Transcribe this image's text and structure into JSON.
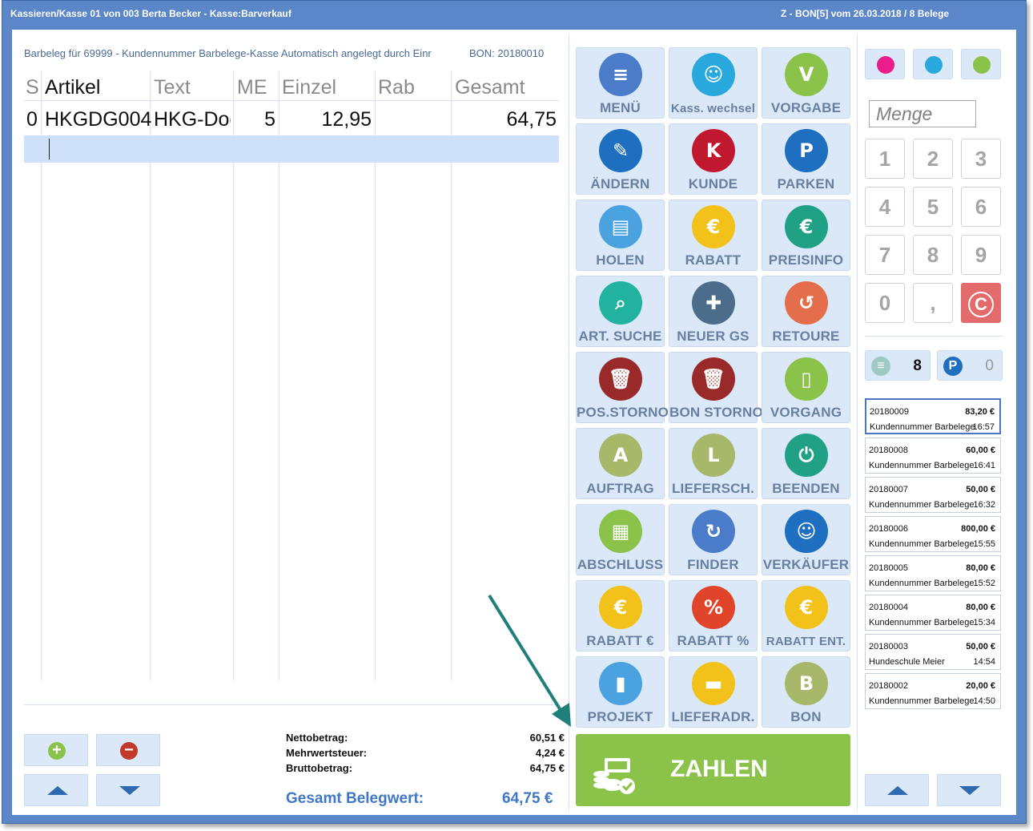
{
  "window": {
    "title_left": "Kassieren/Kasse 01 von 003 Berta Becker - Kasse:Barverkauf",
    "title_right": "Z - BON[5] vom 26.03.2018 / 8 Belege"
  },
  "receipt_info": {
    "description": "Barbeleg für 69999 - Kundennummer Barbelege-Kasse Automatisch angelegt durch Einr",
    "bon": "BON: 20180010"
  },
  "table": {
    "headers": [
      "S",
      "Artikel",
      "Text",
      "ME",
      "Einzel",
      "Rab",
      "Gesamt"
    ],
    "rows": [
      {
        "s": "0",
        "artikel": "HKGDG004",
        "text": "HKG-Dog",
        "me": "5",
        "einzel": "12,95",
        "rab": "",
        "gesamt": "64,75"
      }
    ]
  },
  "totals": {
    "netto_label": "Nettobetrag:",
    "netto_value": "60,51 €",
    "mwst_label": "Mehrwertsteuer:",
    "mwst_value": "4,24 €",
    "brutto_label": "Bruttobetrag:",
    "brutto_value": "64,75 €",
    "gesamt_label": "Gesamt Belegwert:",
    "gesamt_value": "64,75 €"
  },
  "left_nav": {
    "add_icon": "plus-icon",
    "remove_icon": "minus-icon",
    "up_icon": "arrow-up-icon",
    "down_icon": "arrow-down-icon"
  },
  "functions": [
    {
      "label": "MENÜ",
      "icon": "menu-icon",
      "color": "#4a7cc9"
    },
    {
      "label": "Kass. wechsel",
      "icon": "user-switch-icon",
      "color": "#29a8de"
    },
    {
      "label": "VORGABE",
      "icon": "settings-v-icon",
      "color": "#8bc34a"
    },
    {
      "label": "ÄNDERN",
      "icon": "pencil-icon",
      "color": "#1e6fc0"
    },
    {
      "label": "KUNDE",
      "icon": "customer-icon",
      "color": "#c0192f"
    },
    {
      "label": "PARKEN",
      "icon": "parking-icon",
      "color": "#1e6fc0"
    },
    {
      "label": "HOLEN",
      "icon": "receipt-fetch-icon",
      "color": "#4aa3e0"
    },
    {
      "label": "RABATT",
      "icon": "discount-icon",
      "color": "#f2c21a"
    },
    {
      "label": "PREISINFO",
      "icon": "price-info-icon",
      "color": "#20a084"
    },
    {
      "label": "ART. SUCHE",
      "icon": "article-search-icon",
      "color": "#22b3a0"
    },
    {
      "label": "NEUER GS",
      "icon": "voucher-icon",
      "color": "#4b6c8a"
    },
    {
      "label": "RETOURE",
      "icon": "return-icon",
      "color": "#e46e4b"
    },
    {
      "label": "POS.STORNO",
      "icon": "trash-icon",
      "color": "#9a2a2a"
    },
    {
      "label": "BON STORNO",
      "icon": "trash-receipt-icon",
      "color": "#9a2a2a"
    },
    {
      "label": "VORGANG",
      "icon": "document-icon",
      "color": "#8bc34a"
    },
    {
      "label": "AUFTRAG",
      "icon": "document-a-icon",
      "color": "#a8b86a"
    },
    {
      "label": "LIEFERSCH.",
      "icon": "document-l-icon",
      "color": "#a8b86a"
    },
    {
      "label": "BEENDEN",
      "icon": "power-icon",
      "color": "#20a084"
    },
    {
      "label": "ABSCHLUSS",
      "icon": "cash-register-icon",
      "color": "#8bc34a"
    },
    {
      "label": "FINDER",
      "icon": "finder-icon",
      "color": "#4a7cc9"
    },
    {
      "label": "VERKÄUFER",
      "icon": "seller-icon",
      "color": "#1e6fc0"
    },
    {
      "label": "RABATT €",
      "icon": "discount-euro-icon",
      "color": "#f2c21a"
    },
    {
      "label": "RABATT %",
      "icon": "discount-percent-icon",
      "color": "#e0452b"
    },
    {
      "label": "RABATT ENT.",
      "icon": "discount-remove-icon",
      "color": "#f2c21a"
    },
    {
      "label": "PROJEKT",
      "icon": "binder-icon",
      "color": "#4aa3e0"
    },
    {
      "label": "LIEFERADR.",
      "icon": "truck-icon",
      "color": "#f2c21a"
    },
    {
      "label": "BON",
      "icon": "document-b-icon",
      "color": "#a8b86a"
    }
  ],
  "pay": {
    "label": "ZAHLEN",
    "icon": "cash-pay-icon",
    "color": "#8bc34a"
  },
  "quick_icons": [
    {
      "icon": "voucher-pink-icon",
      "color": "#e91e8c"
    },
    {
      "icon": "bag-icon",
      "color": "#29a8de"
    },
    {
      "icon": "cash-green-icon",
      "color": "#8bc34a"
    }
  ],
  "menge": {
    "placeholder": "Menge"
  },
  "keypad": [
    "1",
    "2",
    "3",
    "4",
    "5",
    "6",
    "7",
    "8",
    "9",
    "0",
    ",",
    "C"
  ],
  "counters": {
    "receipts_icon": "receipt-icon",
    "receipts": "8",
    "parked_icon": "parking-icon",
    "parked": "0"
  },
  "receipts": [
    {
      "number": "20180009",
      "amount": "83,20 €",
      "customer": "Kundennummer Barbelege",
      "time": "16:57"
    },
    {
      "number": "20180008",
      "amount": "60,00 €",
      "customer": "Kundennummer Barbelege",
      "time": "16:41"
    },
    {
      "number": "20180007",
      "amount": "50,00 €",
      "customer": "Kundennummer Barbelege",
      "time": "16:32"
    },
    {
      "number": "20180006",
      "amount": "800,00 €",
      "customer": "Kundennummer Barbelege",
      "time": "15:55"
    },
    {
      "number": "20180005",
      "amount": "80,00 €",
      "customer": "Kundennummer Barbelege",
      "time": "15:52"
    },
    {
      "number": "20180004",
      "amount": "80,00 €",
      "customer": "Kundennummer Barbelege",
      "time": "15:34"
    },
    {
      "number": "20180003",
      "amount": "50,00 €",
      "customer": "Hundeschule Meier",
      "time": "14:54"
    },
    {
      "number": "20180002",
      "amount": "20,00 €",
      "customer": "Kundennummer Barbelege",
      "time": "14:50"
    }
  ]
}
